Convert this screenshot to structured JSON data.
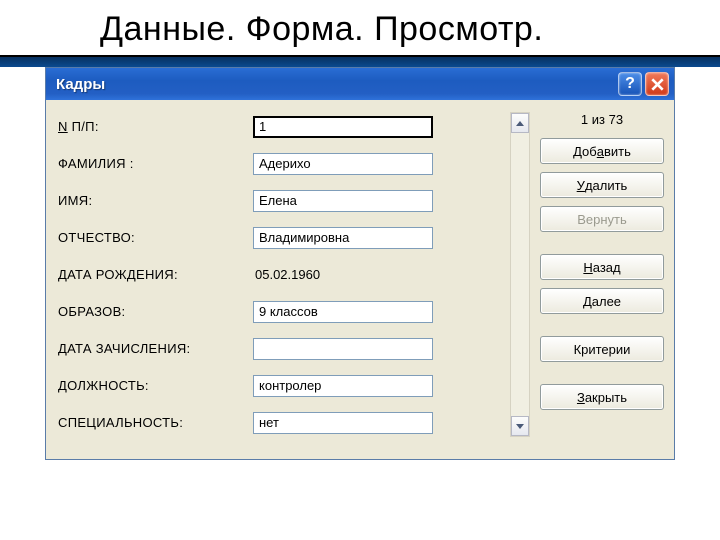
{
  "heading": "Данные. Форма. Просмотр.",
  "title": "Кадры",
  "counter": "1 из 73",
  "fields": {
    "npp": {
      "label_pre": "N",
      "label": " П/П:",
      "value": "1"
    },
    "surname": {
      "label": "ФАМИЛИЯ    :",
      "value": "Адерихо"
    },
    "name": {
      "label": "ИМЯ:",
      "value": "Елена"
    },
    "patronymic": {
      "label": "ОТЧЕСТВО:",
      "value": "Владимировна"
    },
    "birth": {
      "label": "ДАТА РОЖДЕНИЯ:",
      "value": "05.02.1960"
    },
    "edu": {
      "label": "ОБРАЗОВ:",
      "value": "9 классов"
    },
    "hire": {
      "label": "ДАТА ЗАЧИСЛЕНИЯ:",
      "value": ""
    },
    "position": {
      "label": "ДОЛЖНОСТЬ:",
      "value": "контролер"
    },
    "specialty": {
      "label": "СПЕЦИАЛЬНОСТЬ:",
      "value": "нет"
    }
  },
  "buttons": {
    "add": {
      "pre": "Доб",
      "u": "а",
      "post": "вить"
    },
    "delete": {
      "pre": "",
      "u": "У",
      "post": "далить"
    },
    "revert": {
      "text": "Вернуть"
    },
    "back": {
      "pre": "",
      "u": "Н",
      "post": "азад"
    },
    "next": {
      "pre": "",
      "u": "Д",
      "post": "алее"
    },
    "criteria": {
      "text": "Критерии"
    },
    "close": {
      "pre": "",
      "u": "З",
      "post": "акрыть"
    }
  }
}
